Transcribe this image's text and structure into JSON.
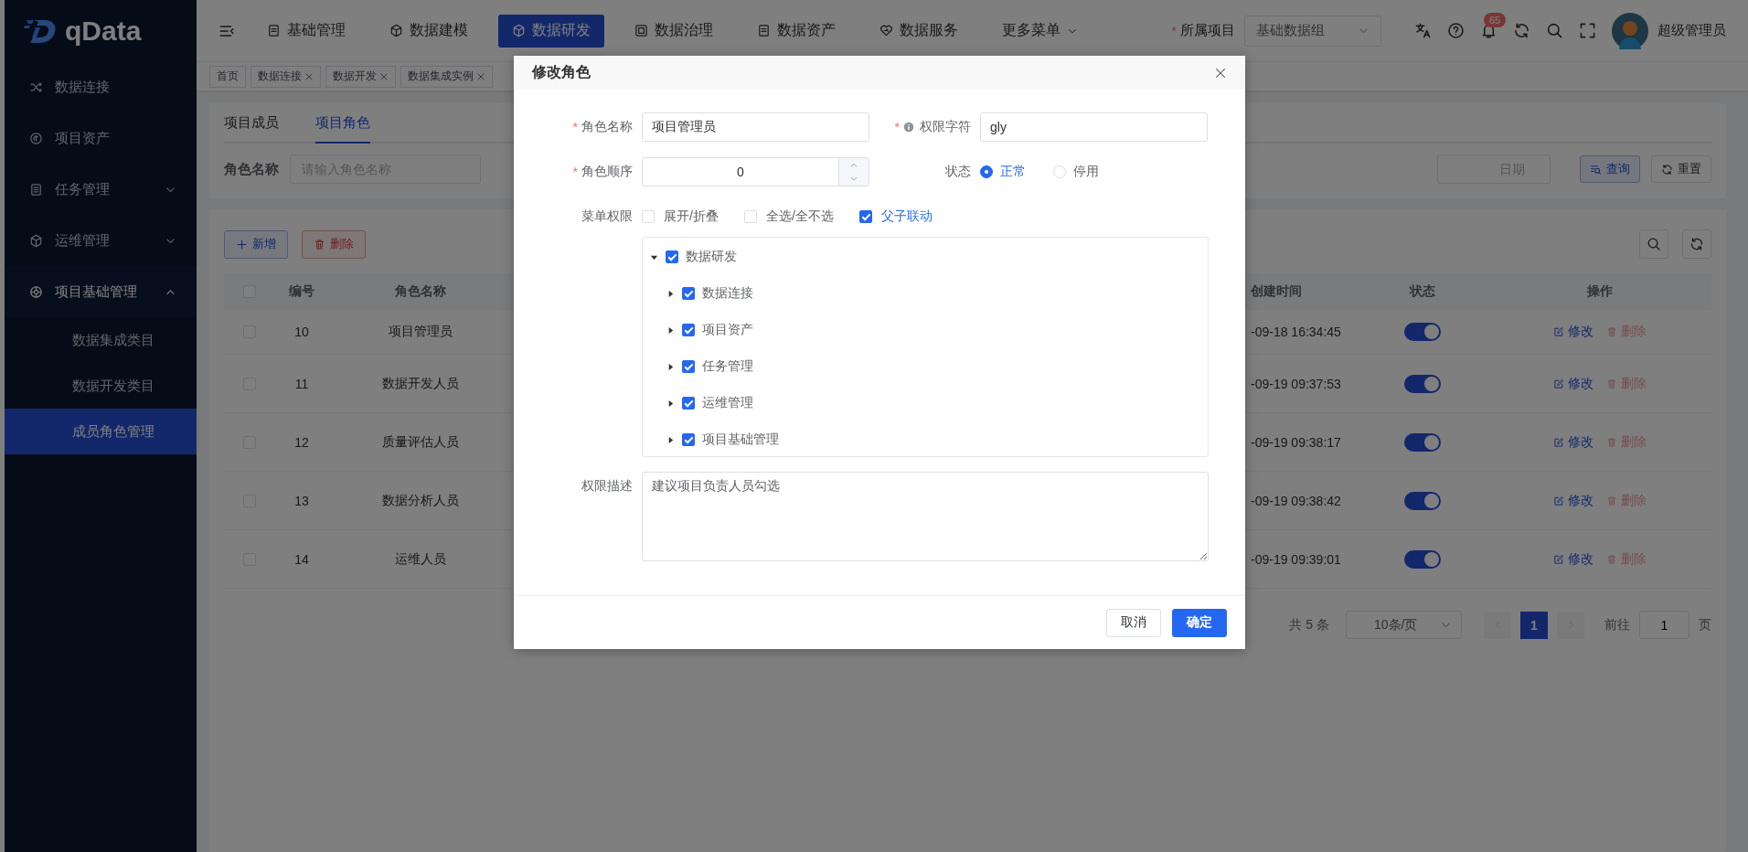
{
  "sidebar": {
    "logo": "qData",
    "items": [
      {
        "label": "数据连接",
        "kind": "link"
      },
      {
        "label": "项目资产",
        "kind": "link"
      },
      {
        "label": "任务管理",
        "kind": "group",
        "expanded": false
      },
      {
        "label": "运维管理",
        "kind": "group",
        "expanded": false
      },
      {
        "label": "项目基础管理",
        "kind": "group",
        "expanded": true,
        "children": [
          {
            "label": "数据集成类目",
            "selected": false
          },
          {
            "label": "数据开发类目",
            "selected": false
          },
          {
            "label": "成员角色管理",
            "selected": true
          }
        ]
      }
    ]
  },
  "header": {
    "nav": [
      {
        "label": "基础管理",
        "selected": false
      },
      {
        "label": "数据建模",
        "selected": false
      },
      {
        "label": "数据研发",
        "selected": true
      },
      {
        "label": "数据治理",
        "selected": false
      },
      {
        "label": "数据资产",
        "selected": false
      },
      {
        "label": "数据服务",
        "selected": false
      }
    ],
    "more_menu": "更多菜单",
    "project_required_mark": "*",
    "project_label": "所属项目",
    "project_value": "基础数据组",
    "badge": "65",
    "user": "超级管理员"
  },
  "tags": [
    {
      "label": "首页",
      "closable": false
    },
    {
      "label": "数据连接",
      "closable": true
    },
    {
      "label": "数据开发",
      "closable": true
    },
    {
      "label": "数据集成实例",
      "closable": true
    }
  ],
  "tabs": [
    {
      "label": "项目成员",
      "selected": false
    },
    {
      "label": "项目角色",
      "selected": true
    }
  ],
  "search": {
    "label": "角色名称",
    "placeholder": "请输入角色名称",
    "date_placeholder": "日期",
    "query": "查询",
    "reset": "重置"
  },
  "toolbar": {
    "add": "新增",
    "delete": "删除"
  },
  "table": {
    "all_checked": false,
    "columns": [
      "编号",
      "角色名称",
      "创建时间",
      "状态",
      "操作"
    ],
    "rows": [
      {
        "id": "10",
        "name": "项目管理员",
        "created": "-09-18 16:34:45",
        "enabled": true,
        "checked": false,
        "edit": "修改",
        "delete": "删除"
      },
      {
        "id": "11",
        "name": "数据开发人员",
        "created": "-09-19 09:37:53",
        "enabled": true,
        "checked": false,
        "edit": "修改",
        "delete": "删除"
      },
      {
        "id": "12",
        "name": "质量评估人员",
        "created": "-09-19 09:38:17",
        "enabled": true,
        "checked": false,
        "edit": "修改",
        "delete": "删除"
      },
      {
        "id": "13",
        "name": "数据分析人员",
        "created": "-09-19 09:38:42",
        "enabled": true,
        "checked": false,
        "edit": "修改",
        "delete": "删除"
      },
      {
        "id": "14",
        "name": "运维人员",
        "created": "-09-19 09:39:01",
        "enabled": true,
        "checked": false,
        "edit": "修改",
        "delete": "删除"
      }
    ]
  },
  "pagination": {
    "total": "共 5 条",
    "page_size": "10条/页",
    "pages": [
      {
        "label": "1",
        "selected": true
      }
    ],
    "goto_label": "前往",
    "goto_value": "1",
    "page_suffix": "页"
  },
  "dialog": {
    "title": "修改角色",
    "role_name": {
      "label": "角色名称",
      "required_mark": "*",
      "value": "项目管理员"
    },
    "role_key": {
      "label": "权限字符",
      "required_mark": "*",
      "value": "gly"
    },
    "role_sort": {
      "label": "角色顺序",
      "required_mark": "*",
      "value": "0"
    },
    "status": {
      "label": "状态",
      "options": [
        {
          "label": "正常",
          "selected": true
        },
        {
          "label": "停用",
          "selected": false
        }
      ]
    },
    "menu": {
      "label": "菜单权限",
      "options": [
        {
          "label": "展开/折叠",
          "checked": false
        },
        {
          "label": "全选/全不选",
          "checked": false
        },
        {
          "label": "父子联动",
          "checked": true
        }
      ],
      "tree": [
        {
          "label": "数据研发",
          "checked": true,
          "expanded": true,
          "children": [
            {
              "label": "数据连接",
              "checked": true,
              "expanded": false
            },
            {
              "label": "项目资产",
              "checked": true,
              "expanded": false
            },
            {
              "label": "任务管理",
              "checked": true,
              "expanded": false
            },
            {
              "label": "运维管理",
              "checked": true,
              "expanded": false
            },
            {
              "label": "项目基础管理",
              "checked": true,
              "expanded": false
            }
          ]
        }
      ]
    },
    "remark": {
      "label": "权限描述",
      "value": "建议项目负责人员勾选"
    },
    "buttons": [
      {
        "label": "取消",
        "kind": "default"
      },
      {
        "label": "确定",
        "kind": "primary"
      }
    ]
  }
}
